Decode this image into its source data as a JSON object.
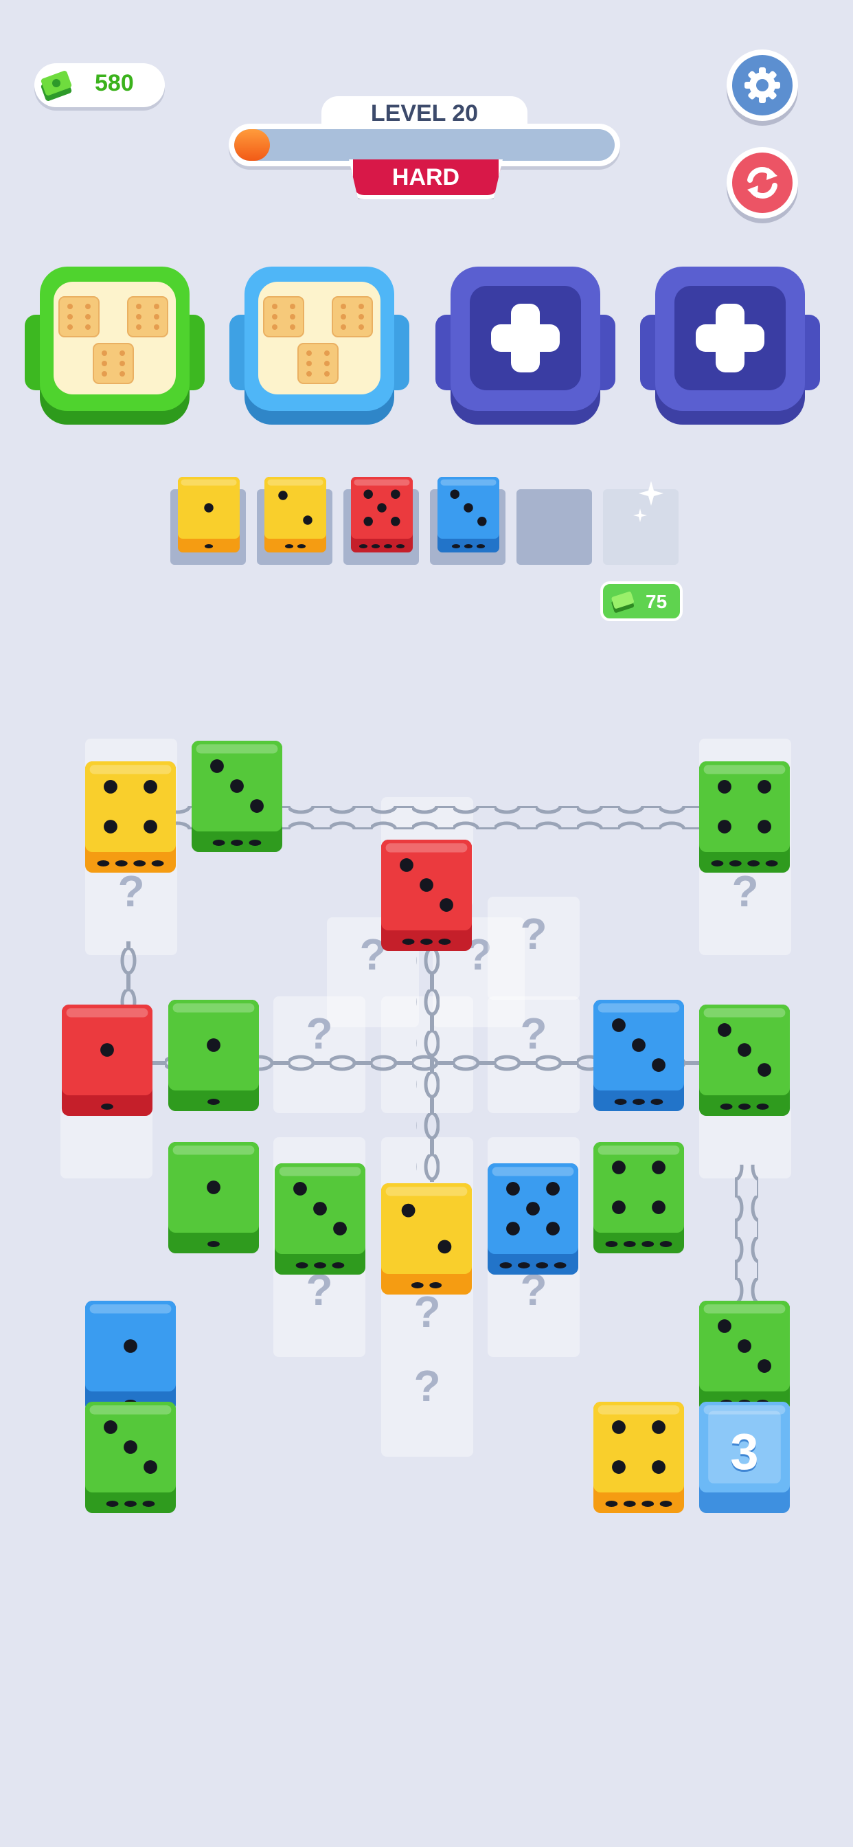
{
  "hud": {
    "cash": "580",
    "level_label": "LEVEL 20",
    "progress": 0.05,
    "difficulty": "HARD",
    "settings_icon": "gear-icon",
    "restart_icon": "restart-icon"
  },
  "boxes": [
    {
      "color": "green",
      "state": "filled"
    },
    {
      "color": "blue",
      "state": "filled"
    },
    {
      "color": "purple",
      "state": "locked"
    },
    {
      "color": "purple",
      "state": "locked"
    }
  ],
  "tray": {
    "slots": [
      {
        "color": "yellow",
        "pips": 1
      },
      {
        "color": "yellow",
        "pips": 2
      },
      {
        "color": "red",
        "pips": 5
      },
      {
        "color": "blue",
        "pips": 3
      },
      {
        "color": "empty",
        "pips": 0
      },
      {
        "color": "glass",
        "pips": 0
      }
    ],
    "unlock_price": "75"
  },
  "board": {
    "freeze_counter": "3",
    "hidden_marker": "?",
    "dice": [
      {
        "color": "yellow",
        "pips": 4
      },
      {
        "color": "green",
        "pips": 3
      },
      {
        "color": "green",
        "pips": 4
      },
      {
        "color": "red",
        "pips": 3
      },
      {
        "color": "red",
        "pips": 1
      },
      {
        "color": "green",
        "pips": 1
      },
      {
        "color": "blue",
        "pips": 3
      },
      {
        "color": "green",
        "pips": 3
      },
      {
        "color": "green",
        "pips": 1
      },
      {
        "color": "green",
        "pips": 3
      },
      {
        "color": "yellow",
        "pips": 2
      },
      {
        "color": "blue",
        "pips": 5
      },
      {
        "color": "green",
        "pips": 4
      },
      {
        "color": "blue",
        "pips": 1
      },
      {
        "color": "green",
        "pips": 3
      },
      {
        "color": "green",
        "pips": 3
      },
      {
        "color": "yellow",
        "pips": 4
      },
      {
        "color": "ice",
        "pips": 0
      }
    ]
  },
  "colors": {
    "yellow": "#f9cf2c",
    "red": "#eb3a3e",
    "green": "#55c83a",
    "blue": "#3a9cf0",
    "ice": "#6cb9f6",
    "box_green": "#4fd32e",
    "box_blue": "#4fb6f7",
    "box_purple": "#5a5fd0"
  }
}
